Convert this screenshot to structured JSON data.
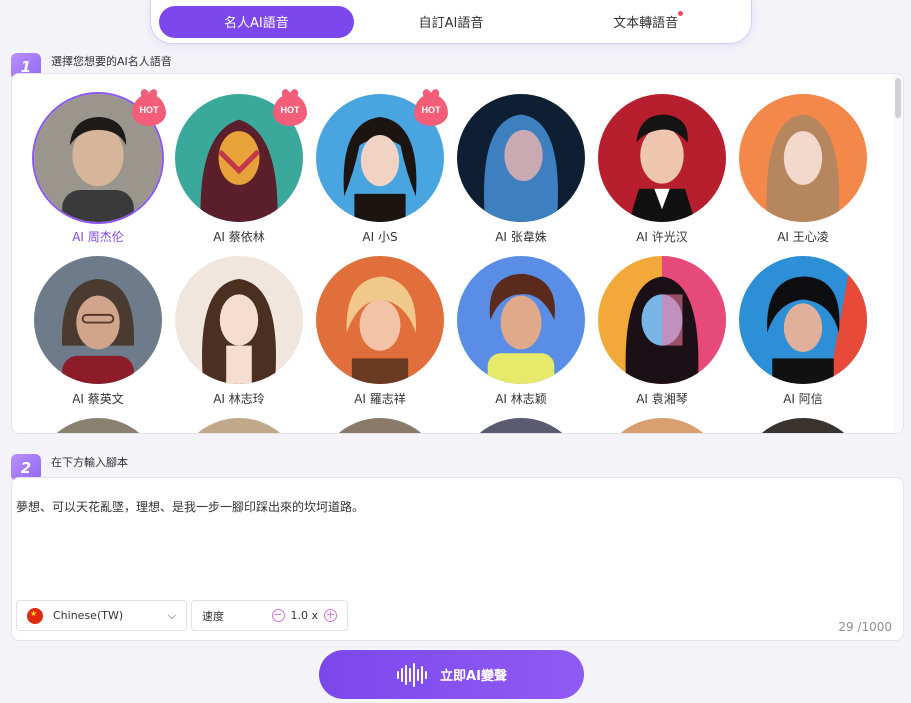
{
  "tabs": [
    {
      "label": "名人AI語音",
      "active": true
    },
    {
      "label": "自訂AI語音",
      "active": false
    },
    {
      "label": "文本轉語音",
      "active": false,
      "has_dot": true
    }
  ],
  "step1": {
    "number": "1",
    "label": "選擇您想要的AI名人語音"
  },
  "step2": {
    "number": "2",
    "label": "在下方輸入腳本"
  },
  "voices": [
    {
      "name": "AI 周杰伦",
      "hot": true,
      "selected": true
    },
    {
      "name": "AI 蔡依林",
      "hot": true
    },
    {
      "name": "AI 小S",
      "hot": true
    },
    {
      "name": "AI 张韋姝"
    },
    {
      "name": "AI 许光汉"
    },
    {
      "name": "AI 王心凌"
    },
    {
      "name": "AI 蔡英文"
    },
    {
      "name": "AI 林志玲"
    },
    {
      "name": "AI 羅志祥"
    },
    {
      "name": "AI 林志颖"
    },
    {
      "name": "AI 袁湘琴"
    },
    {
      "name": "AI 阿信"
    }
  ],
  "hot_label": "HOT",
  "script": {
    "text": "夢想、可以天花亂墜，理想、是我一步一腳印踩出來的坎坷道路。",
    "counter": "29 /1000"
  },
  "language": {
    "value": "Chinese(TW)",
    "flag": "china-flag-icon"
  },
  "speed": {
    "label": "速度",
    "value": "1.0 x",
    "minus": "−",
    "plus": "+"
  },
  "convert_button": {
    "label": "立即AI變聲"
  },
  "colors": {
    "accent": "#7c47ec",
    "hot": "#f25d79",
    "background": "#f3f3f8"
  }
}
